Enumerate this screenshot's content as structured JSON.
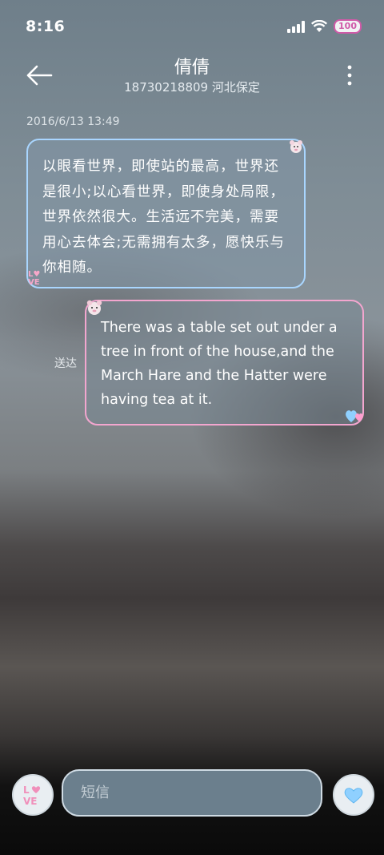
{
  "status_bar": {
    "time": "8:16",
    "battery": "100",
    "icons": [
      "signal-icon",
      "wifi-icon",
      "battery-icon"
    ]
  },
  "header": {
    "contact_name": "倩倩",
    "contact_info": "18730218809 河北保定",
    "back_icon": "back-arrow-icon",
    "more_icon": "more-vertical-icon"
  },
  "conversation": {
    "timestamp": "2016/6/13 13:49",
    "messages": [
      {
        "direction": "incoming",
        "text": "以眼看世界，即使站的最高，世界还是很小;以心看世界，即使身处局限，世界依然很大。生活远不完美，需要用心去体会;无需拥有太多，愿快乐与你相随。"
      },
      {
        "direction": "outgoing",
        "text": "There was a table set out under a tree in front of the house,and the March Hare and the Hatter were having tea at it.",
        "status": "送达"
      }
    ]
  },
  "composer": {
    "placeholder": "短信",
    "left_icon": "love-sticker-icon",
    "send_icon": "heart-send-icon"
  },
  "colors": {
    "incoming_border": "#a9d6ff",
    "outgoing_border": "#f3a6cf",
    "battery_accent": "#d05aa8"
  }
}
